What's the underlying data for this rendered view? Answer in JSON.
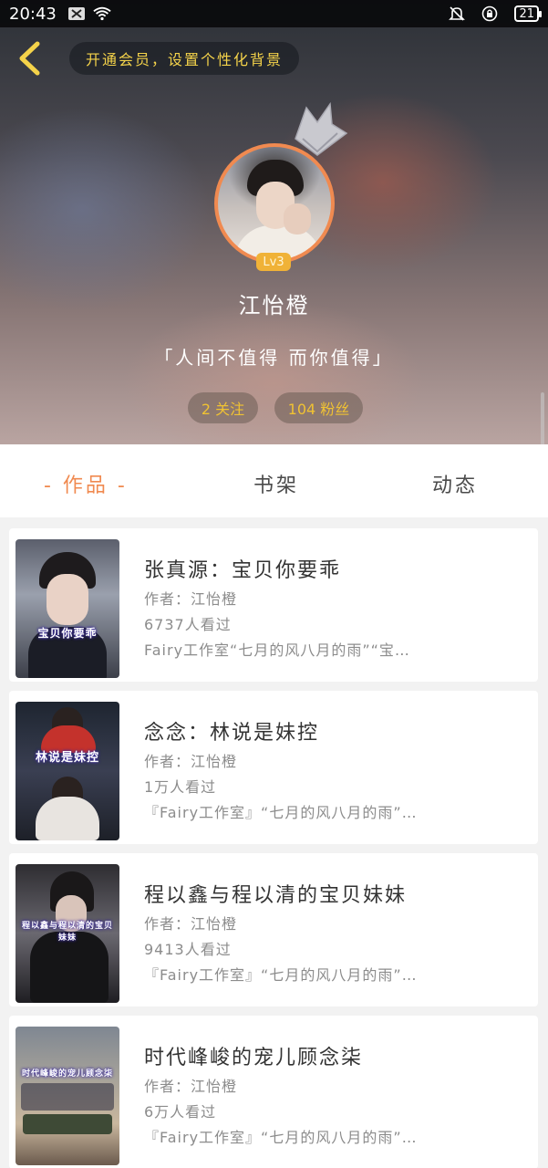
{
  "status_bar": {
    "time": "20:43",
    "battery": "21"
  },
  "header": {
    "vip_prompt": "开通会员，设置个性化背景",
    "level": "Lv3",
    "username": "江怡橙",
    "signature": "「人间不值得 而你值得」",
    "follow_label": "2 关注",
    "fans_label": "104 粉丝"
  },
  "tabs": [
    {
      "label": "- 作品 -",
      "active": true
    },
    {
      "label": "书架",
      "active": false
    },
    {
      "label": "动态",
      "active": false
    }
  ],
  "works": [
    {
      "title": "张真源：宝贝你要乖",
      "author": "作者：江怡橙",
      "views": "6737人看过",
      "desc": "Fairy工作室“七月的风八月的雨”“宝…",
      "thumb_caption": "宝贝你要乖"
    },
    {
      "title": "念念：林说是妹控",
      "author": "作者：江怡橙",
      "views": "1万人看过",
      "desc": "『Fairy工作室』“七月的风八月的雨”…",
      "thumb_caption": "林说是妹控"
    },
    {
      "title": "程以鑫与程以清的宝贝妹妹",
      "author": "作者：江怡橙",
      "views": "9413人看过",
      "desc": "『Fairy工作室』“七月的风八月的雨”…",
      "thumb_caption": "程以鑫与程以清的宝贝妹妹"
    },
    {
      "title": "时代峰峻的宠儿顾念柒",
      "author": "作者：江怡橙",
      "views": "6万人看过",
      "desc": "『Fairy工作室』“七月的风八月的雨”…",
      "thumb_caption": "时代峰峻的宠儿顾念柒"
    }
  ],
  "colors": {
    "accent": "#f08a50",
    "gold": "#f0c233",
    "vip_text": "#f5d34a"
  }
}
